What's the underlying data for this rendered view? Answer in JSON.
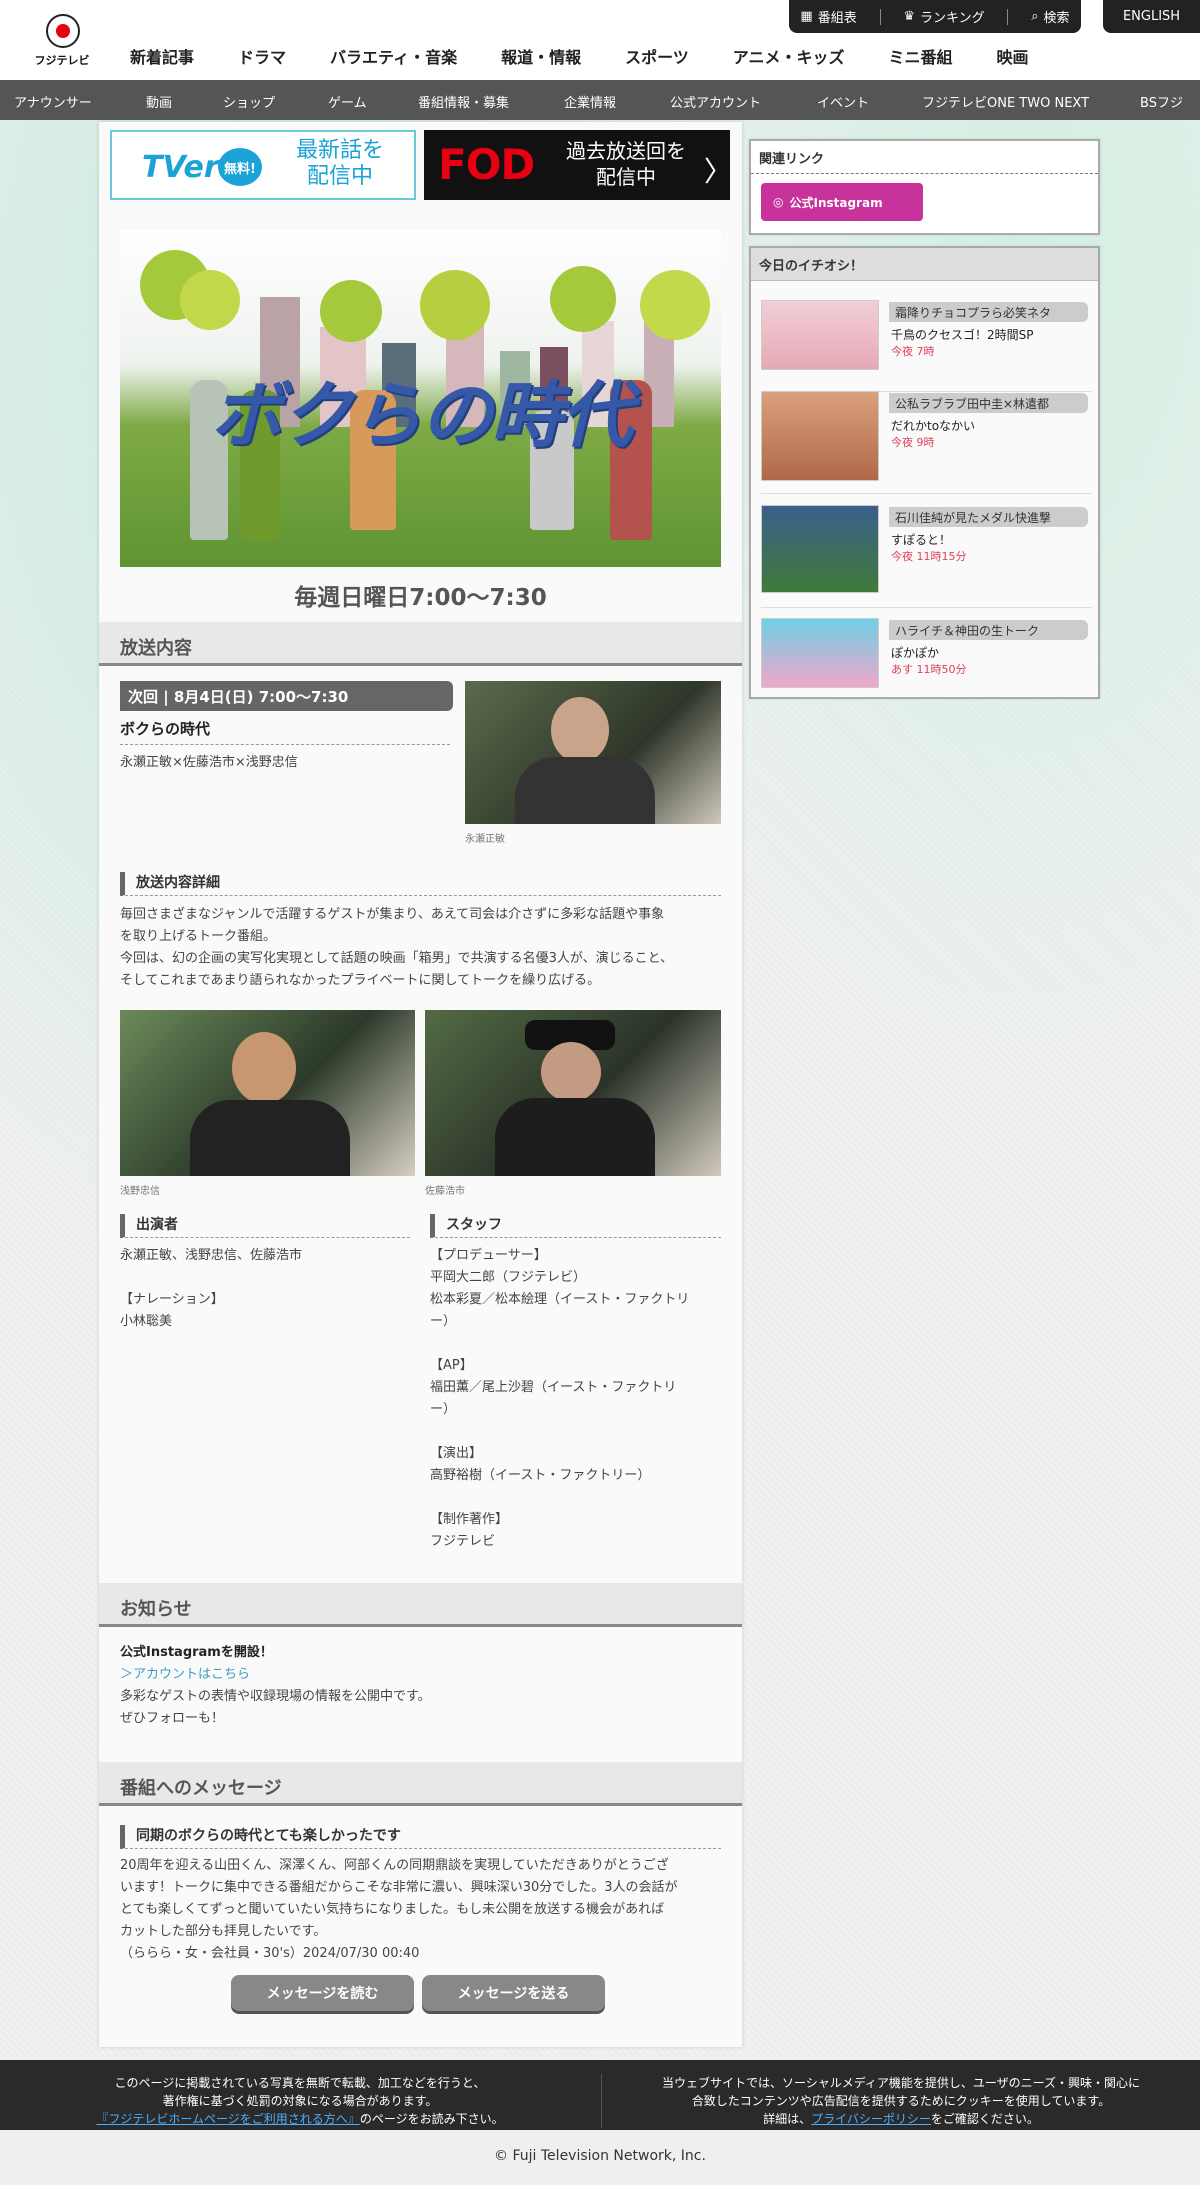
{
  "header": {
    "logo_text": "フジテレビ",
    "utility": [
      "番組表",
      "ランキング",
      "検索"
    ],
    "english": "ENGLISH",
    "main_nav": [
      "新着記事",
      "ドラマ",
      "バラエティ・音楽",
      "報道・情報",
      "スポーツ",
      "アニメ・キッズ",
      "ミニ番組",
      "映画"
    ],
    "sub_nav": [
      "アナウンサー",
      "動画",
      "ショップ",
      "ゲーム",
      "番組情報・募集",
      "企業情報",
      "公式アカウント",
      "イベント",
      "フジテレビONE TWO NEXT",
      "BSフジ"
    ]
  },
  "banners": {
    "tver_logo": "TVer",
    "tver_free": "無料!",
    "tver_line1": "最新話を",
    "tver_line2": "配信中",
    "fod_logo": "FOD",
    "fod_line1": "過去放送回を",
    "fod_line2": "配信中"
  },
  "hero": {
    "title": "ボクらの時代",
    "schedule": "毎週日曜日7:00〜7:30"
  },
  "broadcast": {
    "section_title": "放送内容",
    "next_label": "次回 | 8月4日(日) 7:00〜7:30",
    "episode_title": "ボクらの時代",
    "guests": "永瀬正敏×佐藤浩市×浅野忠信",
    "photo1_caption": "永瀬正敏",
    "detail_heading": "放送内容詳細",
    "detail_p1a": "毎回さまざまなジャンルで活躍するゲストが集まり、あえて司会は介さずに多彩な話題や事象",
    "detail_p1b": "を取り上げるトーク番組。",
    "detail_p2a": "今回は、幻の企画の実写化実現として話題の映画「箱男」で共演する名優3人が、演じること、",
    "detail_p2b": "そしてこれまであまり語られなかったプライベートに関してトークを繰り広げる。",
    "photo2_caption": "浅野忠信",
    "photo3_caption": "佐藤浩市",
    "cast_heading": "出演者",
    "cast_lines": [
      "永瀬正敏、浅野忠信、佐藤浩市",
      "",
      "【ナレーション】",
      "小林聡美"
    ],
    "staff_heading": "スタッフ",
    "staff_lines": [
      "【プロデューサー】",
      "平岡大二郎（フジテレビ）",
      "松本彩夏／松本絵理（イースト・ファクトリ",
      "ー）",
      "",
      "【AP】",
      "福田薫／尾上沙碧（イースト・ファクトリ",
      "ー）",
      "",
      "【演出】",
      "高野裕樹（イースト・ファクトリー）",
      "",
      "【制作著作】",
      "フジテレビ"
    ]
  },
  "news": {
    "section_title": "お知らせ",
    "heading": "公式Instagramを開設！",
    "link": "＞アカウントはこちら",
    "line1": "多彩なゲストの表情や収録現場の情報を公開中です。",
    "line2": "ぜひフォローも！"
  },
  "messages": {
    "section_title": "番組へのメッセージ",
    "heading": "同期のボクらの時代とても楽しかったです",
    "lines": [
      "20周年を迎える山田くん、深澤くん、阿部くんの同期鼎談を実現していただきありがとうござ",
      "います！トークに集中できる番組だからこそな非常に濃い、興味深い30分でした。3人の会話が",
      "とても楽しくてずっと聞いていたい気持ちになりました。もし未公開を放送する機会があれば",
      "カットした部分も拝見したいです。",
      "（ららら・女・会社員・30's）2024/07/30 00:40"
    ],
    "read_button": "メッセージを読む",
    "send_button": "メッセージを送る"
  },
  "sidebar": {
    "related_title": "関連リンク",
    "instagram_label": "公式Instagram",
    "picks_title": "今日のイチオシ！",
    "picks": [
      {
        "tag": "霜降りチョコプラら必笑ネタ",
        "name": "千鳥のクセスゴ！2時間SP",
        "time": "今夜 7時"
      },
      {
        "tag": "公私ラブラブ田中圭×林遣都",
        "name": "だれかtoなかい",
        "time": "今夜 9時"
      },
      {
        "tag": "石川佳純が見たメダル快進撃",
        "name": "すぽると！",
        "time": "今夜 11時15分"
      },
      {
        "tag": "ハライチ＆神田の生トーク",
        "name": "ぽかぽか",
        "time": "あす 11時50分"
      }
    ]
  },
  "footer": {
    "left1": "このページに掲載されている写真を無断で転載、加工などを行うと、",
    "left2": "著作権に基づく処罰の対象になる場合があります。",
    "left_link": "『フジテレビホームページをご利用される方へ』",
    "left3": "のページをお読み下さい。",
    "right1": "当ウェブサイトでは、ソーシャルメディア機能を提供し、ユーザのニーズ・興味・関心に",
    "right2": "合致したコンテンツや広告配信を提供するためにクッキーを使用しています。",
    "right3a": "詳細は、",
    "right_link": "プライバシーポリシー",
    "right3b": "をご確認ください。",
    "copyright": "© Fuji Television Network, Inc."
  },
  "colors": {
    "accent": "#e60012",
    "instagram": "#c8329b",
    "time_text": "#e0405a",
    "link": "#3a9fc0"
  }
}
